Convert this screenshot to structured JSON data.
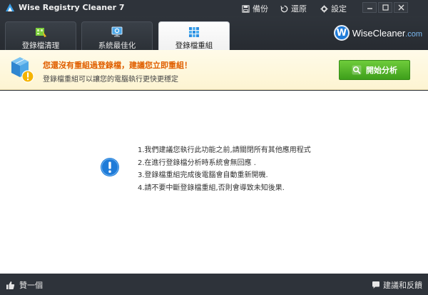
{
  "window": {
    "title": "Wise Registry Cleaner 7",
    "actions": [
      {
        "label": "備份",
        "icon": "save-icon"
      },
      {
        "label": "還原",
        "icon": "restore-icon"
      },
      {
        "label": "設定",
        "icon": "gear-icon"
      }
    ],
    "controls": [
      "minimize-icon",
      "maximize-icon",
      "close-icon"
    ]
  },
  "tabs": [
    {
      "label": "登錄檔清理",
      "icon": "registry-clean-icon",
      "active": false
    },
    {
      "label": "系統最佳化",
      "icon": "monitor-optimize-icon",
      "active": false
    },
    {
      "label": "登錄檔重組",
      "icon": "registry-defrag-icon",
      "active": true
    }
  ],
  "brand": {
    "badge": "W",
    "name": "WiseCleaner",
    "suffix": ".com"
  },
  "alert": {
    "title": "您還沒有重組過登錄檔，建議您立即重組！",
    "subtitle": "登錄檔重組可以讓您的電腦執行更快更穩定",
    "button_label": "開始分析"
  },
  "tips": [
    "1.我們建議您執行此功能之前,請關閉所有其他應用程式",
    "2.在進行登錄檔分析時系統會無回應 .",
    "3.登錄檔重組完成後電腦會自動重新開機.",
    "4.請不要中斷登錄檔重組,否則會導致未知後果."
  ],
  "footer": {
    "like_label": "贊一個",
    "feedback_label": "建議和反饋"
  },
  "colors": {
    "accent_orange": "#e05f00",
    "button_green": "#4cb02a",
    "brand_blue": "#1f7bd8"
  }
}
